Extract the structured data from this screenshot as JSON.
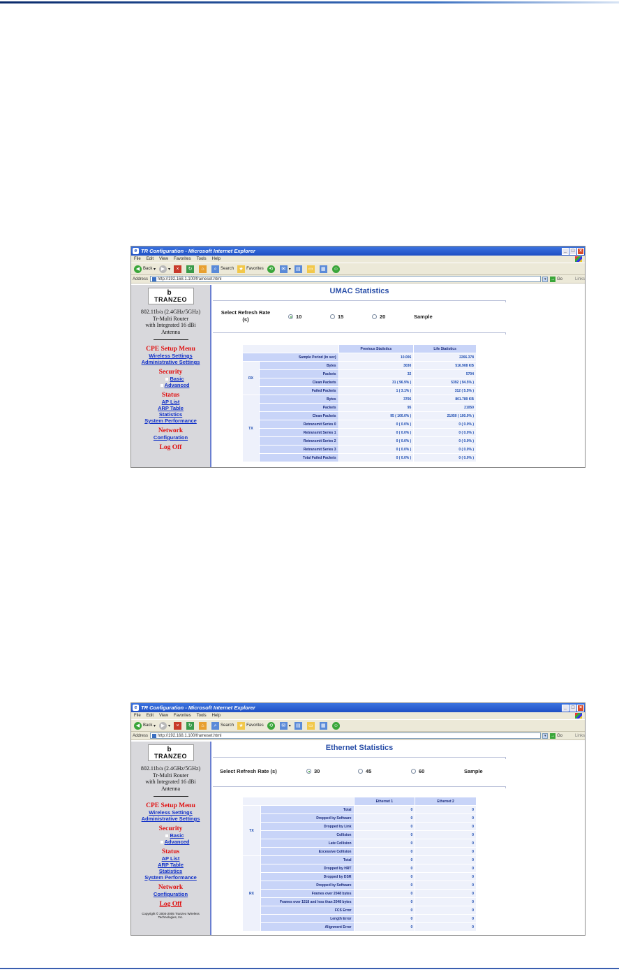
{
  "browser": {
    "window_title": "TR Configuration - Microsoft Internet Explorer",
    "menu": [
      "File",
      "Edit",
      "View",
      "Favorites",
      "Tools",
      "Help"
    ],
    "toolbar": {
      "back": "Back",
      "search": "Search",
      "favorites": "Favorites"
    },
    "address_label": "Address",
    "address_url": "http://192.168.1.100/frameset.html",
    "go_label": "Go",
    "links_label": "Links"
  },
  "sidebar": {
    "logo_glyph": "b",
    "logo_text": "TRANZEO",
    "product_lines": [
      "802.11b/a (2.4GHz/5GHz)",
      "Tr-Multi Router",
      "with Integrated 16 dBi",
      "Antenna"
    ],
    "sections": {
      "cpe_setup": "CPE Setup Menu",
      "wireless_settings": "Wireless Settings",
      "administrative_settings": "Administrative Settings",
      "security": "Security",
      "basic": "Basic",
      "advanced": "Advanced",
      "status": "Status",
      "ap_list": "AP List",
      "arp_table": "ARP Table",
      "statistics": "Statistics",
      "system_performance": "System Performance",
      "network": "Network",
      "configuration": "Configuration",
      "log_off": "Log Off"
    },
    "copyright": "Copyright © 2004-2005 Tranzeo Wireless Technologies, Inc."
  },
  "umac": {
    "title": "UMAC Statistics",
    "refresh_label_1": "Select Refresh Rate",
    "refresh_label_2": "(s)",
    "options": [
      "10",
      "15",
      "20"
    ],
    "selected": "10",
    "sample": "Sample",
    "headers": [
      "Previous Statistics",
      "Life Statistics"
    ],
    "sample_period": {
      "label": "Sample Period (in sec)",
      "prev": "10.006",
      "life": "2266.378"
    },
    "rx_group": "RX",
    "rx_rows": [
      {
        "label": "Bytes",
        "prev": "3030",
        "life": "516.908 KB"
      },
      {
        "label": "Packets",
        "prev": "32",
        "life": "5704"
      },
      {
        "label": "Clean Packets",
        "prev": "31 ( 96.9% )",
        "life": "5392 ( 94.5% )"
      },
      {
        "label": "Failed Packets",
        "prev": "1 ( 3.1% )",
        "life": "312 ( 5.5% )"
      }
    ],
    "tx_group": "TX",
    "tx_rows": [
      {
        "label": "Bytes",
        "prev": "3706",
        "life": "801.789 KB"
      },
      {
        "label": "Packets",
        "prev": "95",
        "life": "21050"
      },
      {
        "label": "Clean Packets",
        "prev": "95 ( 100.0% )",
        "life": "21050 ( 100.0% )"
      },
      {
        "label": "Retransmit Series 0",
        "prev": "0 ( 0.0% )",
        "life": "0 ( 0.0% )"
      },
      {
        "label": "Retransmit Series 1",
        "prev": "0 ( 0.0% )",
        "life": "0 ( 0.0% )"
      },
      {
        "label": "Retransmit Series 2",
        "prev": "0 ( 0.0% )",
        "life": "0 ( 0.0% )"
      },
      {
        "label": "Retransmit Series 3",
        "prev": "0 ( 0.0% )",
        "life": "0 ( 0.0% )"
      },
      {
        "label": "Total Failed Packets",
        "prev": "0 ( 0.0% )",
        "life": "0 ( 0.0% )"
      }
    ]
  },
  "ethernet": {
    "title": "Ethernet Statistics",
    "refresh_label": "Select Refresh Rate (s)",
    "options": [
      "30",
      "45",
      "60"
    ],
    "selected": "30",
    "sample": "Sample",
    "headers": [
      "Ethernet 1",
      "Ethernet 2"
    ],
    "tx_group": "TX",
    "tx_rows": [
      {
        "label": "Total",
        "e1": "0",
        "e2": "0"
      },
      {
        "label": "Dropped by Software",
        "e1": "0",
        "e2": "0"
      },
      {
        "label": "Dropped by Link",
        "e1": "0",
        "e2": "0"
      },
      {
        "label": "Collision",
        "e1": "0",
        "e2": "0"
      },
      {
        "label": "Late Collision",
        "e1": "0",
        "e2": "0"
      },
      {
        "label": "Excessive Collision",
        "e1": "0",
        "e2": "0"
      }
    ],
    "rx_group": "RX",
    "rx_rows": [
      {
        "label": "Total",
        "e1": "0",
        "e2": "0"
      },
      {
        "label": "Dropped by HRT",
        "e1": "0",
        "e2": "0"
      },
      {
        "label": "Dropped by DSR",
        "e1": "0",
        "e2": "0"
      },
      {
        "label": "Dropped by Software",
        "e1": "0",
        "e2": "0"
      },
      {
        "label": "Frames over 2048 bytes",
        "e1": "0",
        "e2": "0"
      },
      {
        "label": "Frames over 1518 and less than 2048 bytes",
        "e1": "0",
        "e2": "0"
      },
      {
        "label": "FCS Error",
        "e1": "0",
        "e2": "0"
      },
      {
        "label": "Length Error",
        "e1": "0",
        "e2": "0"
      },
      {
        "label": "Alignment Error",
        "e1": "0",
        "e2": "0"
      }
    ]
  }
}
